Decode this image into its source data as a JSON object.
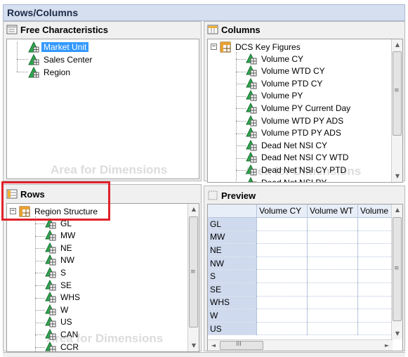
{
  "title": "Rows/Columns",
  "free_characteristics": {
    "header": "Free Characteristics",
    "items": [
      "Market Unit",
      "Sales Center",
      "Region"
    ],
    "selected": "Market Unit",
    "watermark": "Area for Dimensions"
  },
  "columns": {
    "header": "Columns",
    "root": "DCS Key Figures",
    "items": [
      "Volume CY",
      "Volume WTD CY",
      "Volume PTD CY",
      "Volume PY",
      "Volume PY Current Day",
      "Volume WTD PY ADS",
      "Volume PTD PY ADS",
      "Dead Net NSI CY",
      "Dead Net NSI CY WTD",
      "Dead Net NSI CY PTD",
      "Dead Net NSI PY"
    ],
    "watermark": "Area for Dimensions"
  },
  "rows": {
    "header": "Rows",
    "root": "Region Structure",
    "items": [
      "GL",
      "MW",
      "NE",
      "NW",
      "S",
      "SE",
      "WHS",
      "W",
      "US",
      "CAN",
      "CCR"
    ],
    "watermark": "Area for Dimensions"
  },
  "preview": {
    "header": "Preview",
    "columns": [
      "Volume CY",
      "Volume WT",
      "Volume"
    ],
    "rows": [
      "GL",
      "MW",
      "NE",
      "NW",
      "S",
      "SE",
      "WHS",
      "W",
      "US"
    ]
  },
  "scroll": {
    "up": "▲",
    "down": "▼",
    "left": "◄",
    "right": "►",
    "grip_v": "≡",
    "grip_h": "III"
  },
  "icons": {
    "kf": "key-figure-icon",
    "hierarchy": "hierarchy-icon"
  },
  "colors": {
    "selection": "#3399ff",
    "highlight_box": "#e0222a"
  }
}
